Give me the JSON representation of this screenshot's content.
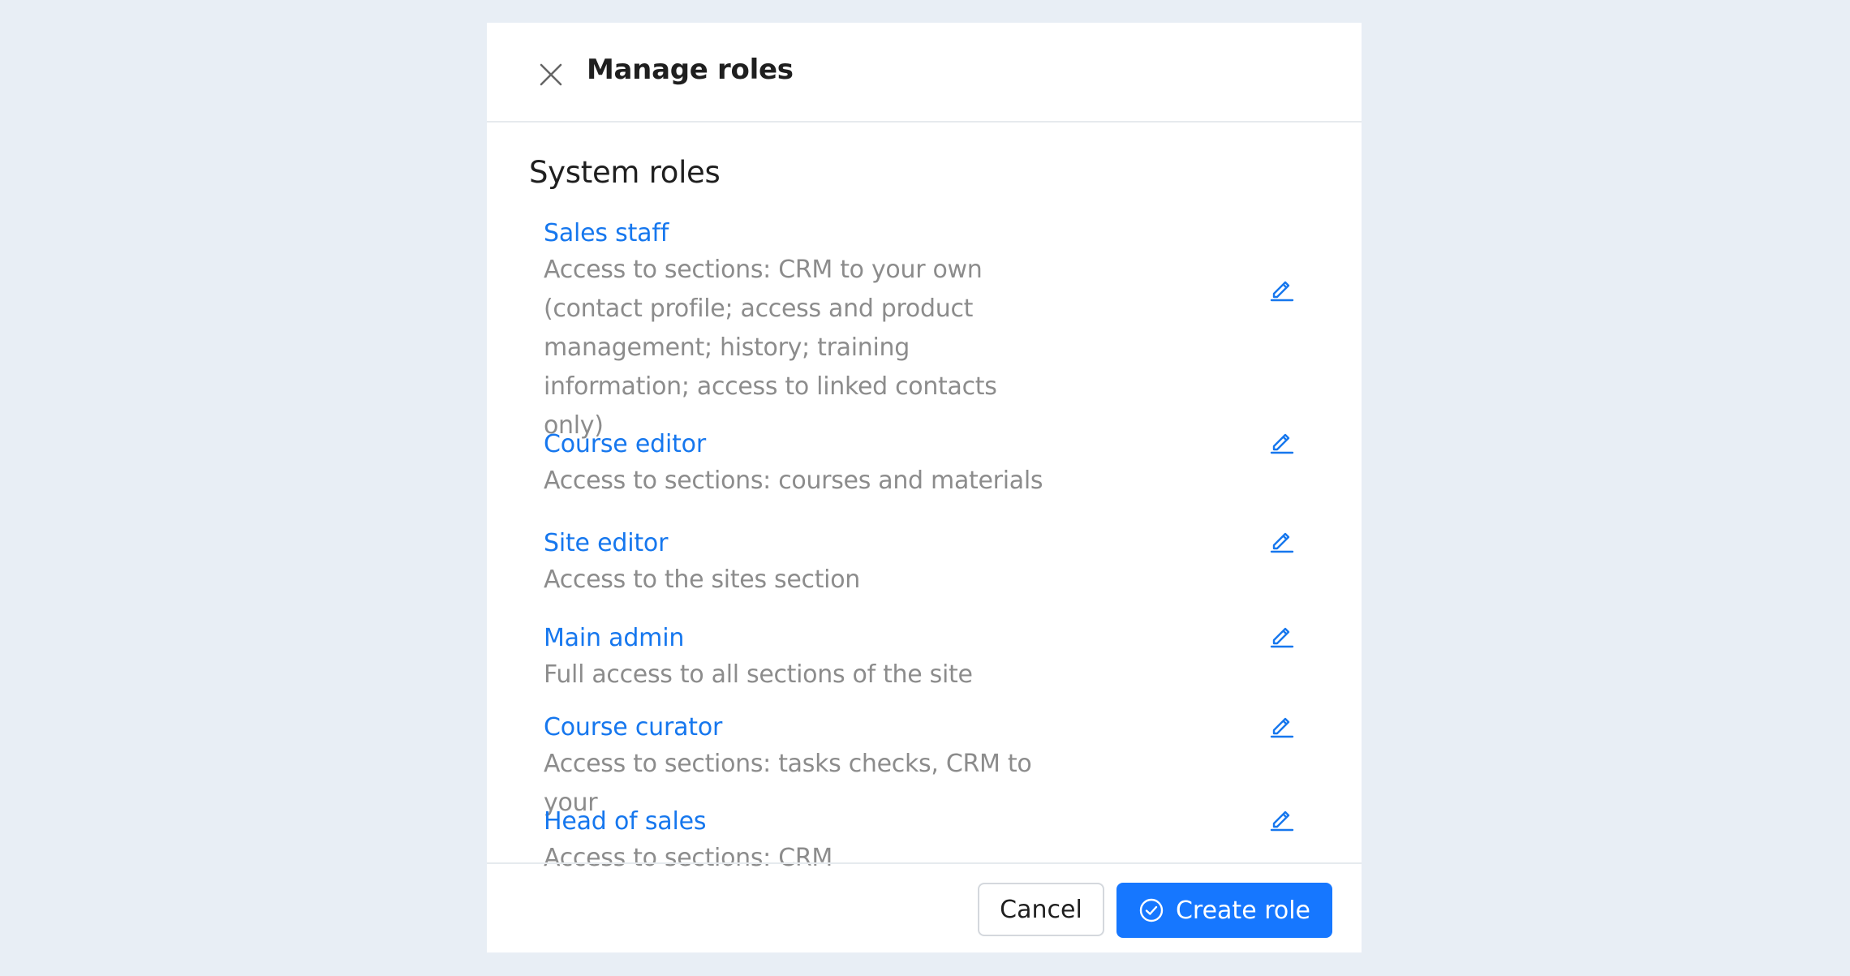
{
  "modal": {
    "title": "Manage roles",
    "close_icon": "close-icon"
  },
  "section": {
    "title": "System roles"
  },
  "roles": [
    {
      "name": "Sales staff",
      "description": "Access to sections: CRM to your own (contact profile; access and product management; history; training information; access to linked contacts only)",
      "edit_icon": "pencil-icon"
    },
    {
      "name": "Course editor",
      "description": "Access to sections: courses and materials",
      "edit_icon": "pencil-icon"
    },
    {
      "name": "Site editor",
      "description": "Access to the sites section",
      "edit_icon": "pencil-icon"
    },
    {
      "name": "Main admin",
      "description": "Full access to all sections of the site",
      "edit_icon": "pencil-icon"
    },
    {
      "name": "Course curator",
      "description": "Access to sections: tasks checks, CRM to your",
      "edit_icon": "pencil-icon"
    },
    {
      "name": "Head of sales",
      "description": "Access to sections: CRM",
      "edit_icon": "pencil-icon"
    }
  ],
  "footer": {
    "cancel_label": "Cancel",
    "create_label": "Create role",
    "create_icon": "check-circle-icon"
  },
  "colors": {
    "background": "#e8eef5",
    "accent": "#1677ff",
    "link": "#1677ee",
    "muted_text": "#8c8c8c"
  }
}
